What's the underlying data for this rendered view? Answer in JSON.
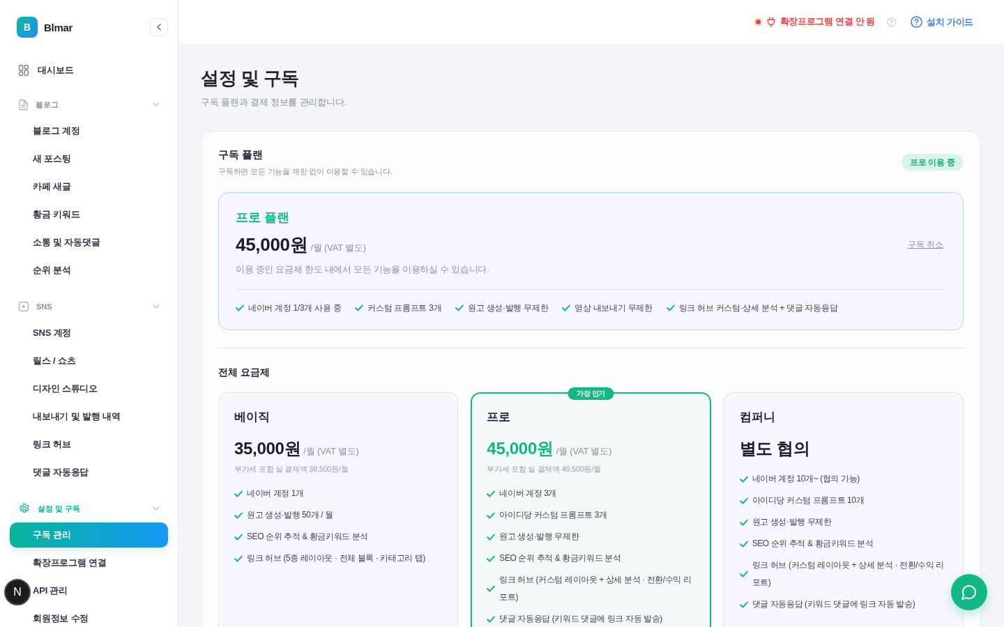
{
  "sidebar": {
    "brand": {
      "letter": "B",
      "name": "Blmar"
    },
    "items": [
      {
        "kind": "link",
        "label": "대시보드",
        "selected": false
      },
      {
        "kind": "group",
        "label": "블로그",
        "expanded": true,
        "children": [
          {
            "label": "블로그 계정",
            "selected": false
          },
          {
            "label": "새 포스팅",
            "selected": false
          },
          {
            "label": "카페 새글",
            "selected": false
          },
          {
            "label": "황금 키워드",
            "selected": false
          },
          {
            "label": "소통 및 자동댓글",
            "selected": false
          },
          {
            "label": "순위 분석",
            "selected": false
          }
        ]
      },
      {
        "kind": "group",
        "label": "SNS",
        "expanded": true,
        "children": [
          {
            "label": "SNS 계정",
            "selected": false
          },
          {
            "label": "릴스 / 쇼츠",
            "selected": false
          },
          {
            "label": "디자인 스튜디오",
            "selected": false
          },
          {
            "label": "내보내기 및 발행 내역",
            "selected": false
          },
          {
            "label": "링크 허브",
            "selected": false
          },
          {
            "label": "댓글 자동응답",
            "selected": false
          }
        ]
      },
      {
        "kind": "group",
        "label": "설정 및 구독",
        "expanded": true,
        "children": [
          {
            "label": "구독 관리",
            "selected": true
          },
          {
            "label": "확장프로그램 연결",
            "selected": false
          },
          {
            "label": "API 관리",
            "selected": false
          },
          {
            "label": "회원정보 수정",
            "selected": false
          }
        ]
      }
    ]
  },
  "dev_indicator": {
    "label": "N"
  },
  "header": {
    "extension_status": {
      "label": "확장프로그램 연결 안 됨",
      "connected": false
    },
    "guide_link": {
      "label": "설치 가이드"
    }
  },
  "page": {
    "title": "설정 및 구독",
    "subtitle": "구독 플랜과 결제 정보를 관리합니다."
  },
  "subscription": {
    "title": "구독 플랜",
    "subtitle": "구독하면 모든 기능을 제한 없이 이용할 수 있습니다.",
    "status_badge": "프로 이용 중",
    "current_plan": {
      "name": "프로 플랜",
      "price": "45,000원",
      "unit": "/월 (VAT 별도)",
      "cancel_link": "구독 취소",
      "description": "이용 중인 요금제 한도 내에서 모든 기능을 이용하실 수 있습니다.",
      "features": [
        "네이버 계정 1/3개 사용 중",
        "커스텀 프롬프트 3개",
        "원고 생성·발행 무제한",
        "영상 내보내기 무제한",
        "링크 허브 커스텀·상세 분석 + 댓글 자동응답"
      ]
    }
  },
  "plans": {
    "title": "전체 요금제",
    "items": [
      {
        "name": "베이직",
        "featured": false,
        "price": "35,000원",
        "unit": "/월 (VAT 별도)",
        "note": "부가세 포함 실 결제액 38,500원/월",
        "features": [
          "네이버 계정 1개",
          "원고 생성·발행 50개 / 월",
          "SEO 순위 추적 & 황금키워드 분석",
          "링크 허브 (5종 레이아웃 · 전체 블록 · 카테고리 탭)"
        ]
      },
      {
        "name": "프로",
        "featured": true,
        "badge": "가장 인기",
        "price": "45,000원",
        "unit": "/월 (VAT 별도)",
        "note": "부가세 포함 실 결제액 49,500원/월",
        "features": [
          "네이버 계정 3개",
          "아이디당 커스텀 프롬프트 3개",
          "원고 생성·발행 무제한",
          "SEO 순위 추적 & 황금키워드 분석",
          "링크 허브 (커스텀 레이아웃 + 상세 분석 · 전환/수익 리포트)",
          "댓글 자동응답 (키워드 댓글에 링크 자동 발송)"
        ]
      },
      {
        "name": "컴퍼니",
        "featured": false,
        "price": "별도 협의",
        "features": [
          "네이버 계정 10개~ (협의 가능)",
          "아이디당 커스텀 프롬프트 10개",
          "원고 생성·발행 무제한",
          "SEO 순위 추적 & 황금키워드 분석",
          "링크 허브 (커스텀 레이아웃 + 상세 분석 · 전환/수익 리포트)",
          "댓글 자동응답 (키워드 댓글에 링크 자동 발송)"
        ]
      }
    ]
  }
}
